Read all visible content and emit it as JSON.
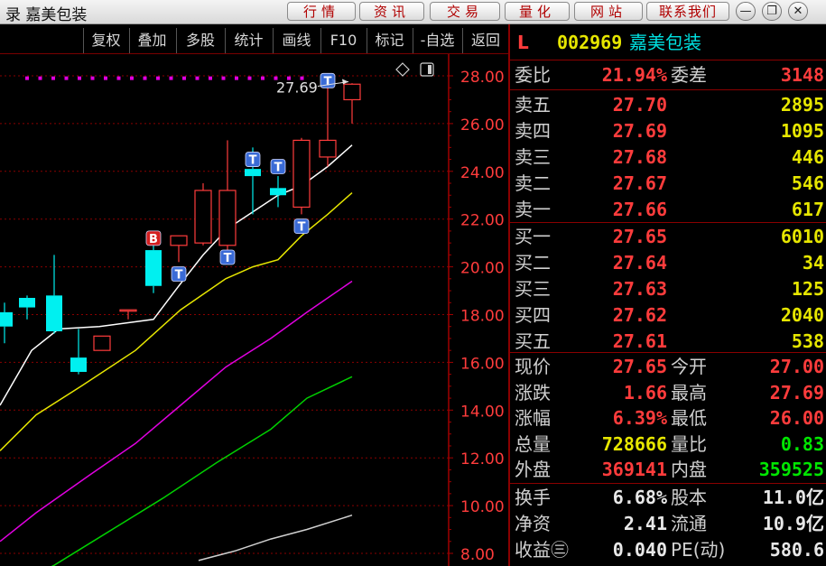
{
  "window": {
    "title": "录 嘉美包装",
    "buttons": [
      "行情",
      "资讯",
      "交易",
      "量化",
      "网站",
      "联系我们"
    ],
    "controls": [
      "—",
      "❐",
      "✕"
    ]
  },
  "chart_toolbar": [
    "复权",
    "叠加",
    "多股",
    "统计",
    "画线",
    "F10",
    "标记",
    "-自选",
    "返回"
  ],
  "quote_header": {
    "marker": "L",
    "code": "002969",
    "name": "嘉美包装"
  },
  "order_ratio": {
    "wb_label": "委比",
    "wb_value": "21.94%",
    "wc_label": "委差",
    "wc_value": "3148"
  },
  "sell": [
    {
      "label": "卖五",
      "price": "27.70",
      "vol": "2895"
    },
    {
      "label": "卖四",
      "price": "27.69",
      "vol": "1095"
    },
    {
      "label": "卖三",
      "price": "27.68",
      "vol": "446"
    },
    {
      "label": "卖二",
      "price": "27.67",
      "vol": "546"
    },
    {
      "label": "卖一",
      "price": "27.66",
      "vol": "617"
    }
  ],
  "buy": [
    {
      "label": "买一",
      "price": "27.65",
      "vol": "6010"
    },
    {
      "label": "买二",
      "price": "27.64",
      "vol": "34"
    },
    {
      "label": "买三",
      "price": "27.63",
      "vol": "125"
    },
    {
      "label": "买四",
      "price": "27.62",
      "vol": "2040"
    },
    {
      "label": "买五",
      "price": "27.61",
      "vol": "538"
    }
  ],
  "stats1": [
    {
      "l1": "现价",
      "v1": "27.65",
      "c1": "red",
      "l2": "今开",
      "v2": "27.00",
      "c2": "red"
    },
    {
      "l1": "涨跌",
      "v1": "1.66",
      "c1": "red",
      "l2": "最高",
      "v2": "27.69",
      "c2": "red"
    },
    {
      "l1": "涨幅",
      "v1": "6.39%",
      "c1": "red",
      "l2": "最低",
      "v2": "26.00",
      "c2": "red"
    },
    {
      "l1": "总量",
      "v1": "728666",
      "c1": "yel",
      "l2": "量比",
      "v2": "0.83",
      "c2": "grn"
    },
    {
      "l1": "外盘",
      "v1": "369141",
      "c1": "red",
      "l2": "内盘",
      "v2": "359525",
      "c2": "grn"
    }
  ],
  "stats2": [
    {
      "l1": "换手",
      "v1": "6.68%",
      "l2": "股本",
      "v2": "11.0亿"
    },
    {
      "l1": "净资",
      "v1": "2.41",
      "l2": "流通",
      "v2": "10.9亿"
    },
    {
      "l1": "收益㊂",
      "v1": "0.040",
      "l2": "PE(动)",
      "v2": "580.6"
    }
  ],
  "chart_data": {
    "type": "candlestick",
    "y_ticks": [
      "28.00",
      "26.00",
      "24.00",
      "22.00",
      "20.00",
      "18.00",
      "16.00",
      "14.00",
      "12.00",
      "10.00",
      "8.00"
    ],
    "ylim": [
      7.7,
      28.8
    ],
    "price_label": "27.69",
    "candles": [
      {
        "x": 5,
        "o": 18.1,
        "c": 17.5,
        "h": 18.5,
        "l": 16.8
      },
      {
        "x": 30,
        "o": 18.7,
        "c": 18.3,
        "h": 18.8,
        "l": 17.8
      },
      {
        "x": 60,
        "o": 18.8,
        "c": 17.3,
        "h": 20.5,
        "l": 17.2
      },
      {
        "x": 87,
        "o": 16.2,
        "c": 15.6,
        "h": 17.4,
        "l": 15.5
      },
      {
        "x": 113,
        "o": 16.5,
        "c": 17.1,
        "h": 17.1,
        "l": 16.5
      },
      {
        "x": 142,
        "o": 18.2,
        "c": 18.2,
        "h": 18.2,
        "l": 17.8
      },
      {
        "x": 170,
        "o": 20.7,
        "c": 19.2,
        "h": 20.9,
        "l": 18.9
      },
      {
        "x": 198,
        "o": 20.9,
        "c": 21.3,
        "h": 21.3,
        "l": 20.2
      },
      {
        "x": 225,
        "o": 21.0,
        "c": 23.2,
        "h": 23.5,
        "l": 20.9
      },
      {
        "x": 252,
        "o": 20.9,
        "c": 23.2,
        "h": 25.3,
        "l": 20.5
      },
      {
        "x": 280,
        "o": 24.1,
        "c": 23.8,
        "h": 25.0,
        "l": 22.2
      },
      {
        "x": 308,
        "o": 23.3,
        "c": 23.0,
        "h": 23.8,
        "l": 22.5
      },
      {
        "x": 334,
        "o": 22.5,
        "c": 25.3,
        "h": 25.4,
        "l": 22.2
      },
      {
        "x": 363,
        "o": 24.6,
        "c": 25.3,
        "h": 27.6,
        "l": 24.2
      },
      {
        "x": 390,
        "o": 27.0,
        "c": 27.65,
        "h": 27.69,
        "l": 26.0
      }
    ],
    "markers": [
      {
        "x": 170,
        "p": 21.2,
        "kind": "B"
      },
      {
        "x": 198,
        "p": 19.7,
        "kind": "T"
      },
      {
        "x": 252,
        "p": 20.4,
        "kind": "T"
      },
      {
        "x": 280,
        "p": 24.5,
        "kind": "T"
      },
      {
        "x": 308,
        "p": 24.2,
        "kind": "T"
      },
      {
        "x": 334,
        "p": 21.7,
        "kind": "T"
      },
      {
        "x": 363,
        "p": 27.8,
        "kind": "T"
      }
    ],
    "dotted_level": 27.9,
    "ma": [
      {
        "name": "MA-white",
        "color": "#ffffff",
        "pts": [
          [
            0,
            14.2
          ],
          [
            35,
            16.5
          ],
          [
            65,
            17.4
          ],
          [
            110,
            17.5
          ],
          [
            170,
            17.8
          ],
          [
            198,
            19.2
          ],
          [
            225,
            20.5
          ],
          [
            252,
            21.6
          ],
          [
            280,
            22.3
          ],
          [
            308,
            23.0
          ],
          [
            334,
            23.4
          ],
          [
            363,
            24.2
          ],
          [
            390,
            25.1
          ]
        ]
      },
      {
        "name": "MA-yellow",
        "color": "#e6e600",
        "pts": [
          [
            0,
            12.3
          ],
          [
            40,
            13.8
          ],
          [
            90,
            15.0
          ],
          [
            150,
            16.5
          ],
          [
            200,
            18.2
          ],
          [
            250,
            19.5
          ],
          [
            280,
            20.0
          ],
          [
            308,
            20.3
          ],
          [
            334,
            21.3
          ],
          [
            363,
            22.2
          ],
          [
            390,
            23.1
          ]
        ]
      },
      {
        "name": "MA-magenta",
        "color": "#e000e0",
        "pts": [
          [
            0,
            8.5
          ],
          [
            40,
            9.7
          ],
          [
            100,
            11.3
          ],
          [
            150,
            12.6
          ],
          [
            200,
            14.2
          ],
          [
            250,
            15.8
          ],
          [
            300,
            17.0
          ],
          [
            340,
            18.1
          ],
          [
            390,
            19.4
          ]
        ]
      },
      {
        "name": "MA-green",
        "color": "#00d000",
        "pts": [
          [
            0,
            6.4
          ],
          [
            60,
            7.5
          ],
          [
            120,
            8.9
          ],
          [
            180,
            10.3
          ],
          [
            240,
            11.8
          ],
          [
            300,
            13.2
          ],
          [
            340,
            14.5
          ],
          [
            390,
            15.4
          ]
        ]
      },
      {
        "name": "MA-gray",
        "color": "#d0d0d0",
        "pts": [
          [
            220,
            7.7
          ],
          [
            260,
            8.1
          ],
          [
            300,
            8.6
          ],
          [
            340,
            9.0
          ],
          [
            390,
            9.6
          ]
        ]
      }
    ]
  }
}
